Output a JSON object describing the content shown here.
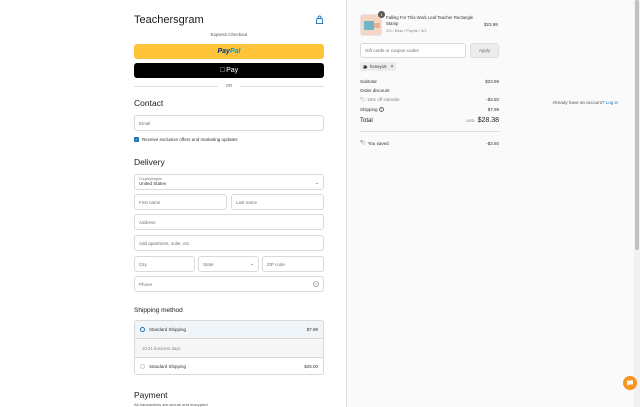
{
  "store": {
    "name": "Teachersgram"
  },
  "express": {
    "title": "Express Checkout",
    "paypal_label_1": "Pay",
    "paypal_label_2": "Pal",
    "applepay_label": "Pay",
    "or_label": "OR"
  },
  "contact": {
    "heading": "Contact",
    "login_prompt": "Already have an account?",
    "login_link": "Log in",
    "email_placeholder": "Email",
    "offers_label": "Receive exclusive offers and marketing updates"
  },
  "delivery": {
    "heading": "Delivery",
    "country_label": "Country/region",
    "country_value": "United States",
    "first_name": "First name",
    "last_name": "Last name",
    "address": "Address",
    "apartment": "Add apartment, suite, etc.",
    "city": "City",
    "state": "State",
    "zip": "ZIP code",
    "phone": "Phone"
  },
  "shipping": {
    "heading": "Shipping method",
    "options": [
      {
        "label": "Standard Shipping",
        "price": "$7.99",
        "note": "10-21 business days"
      },
      {
        "label": "Standard Shipping",
        "price": "$25.00"
      }
    ]
  },
  "payment": {
    "heading": "Payment",
    "subtitle": "All transactions are secure and encrypted."
  },
  "order": {
    "quantity": "1",
    "item_title": "Falling For This Work Leaf Teacher Rectangle Stamp",
    "item_variant": "3/4 / Blue / Purple / 3/2",
    "item_price": "$23.99",
    "coupon_placeholder": "Gift cards or coupon codes",
    "apply_label": "Apply",
    "discount_code": "honey15",
    "subtotal_label": "Subtotal",
    "subtotal_value": "$23.99",
    "order_discount_label": "Order discount",
    "discount_detail": "15% off sitewide",
    "discount_value": "-$3.60",
    "shipping_label": "Shipping",
    "shipping_value": "$7.99",
    "total_label": "Total",
    "currency": "USD",
    "total_value": "$28.38",
    "saved_label": "You saved",
    "saved_value": "-$3.60"
  },
  "colors": {
    "paypal_bg": "#ffc439",
    "accent": "#1773b0",
    "chat": "#f7931e"
  }
}
